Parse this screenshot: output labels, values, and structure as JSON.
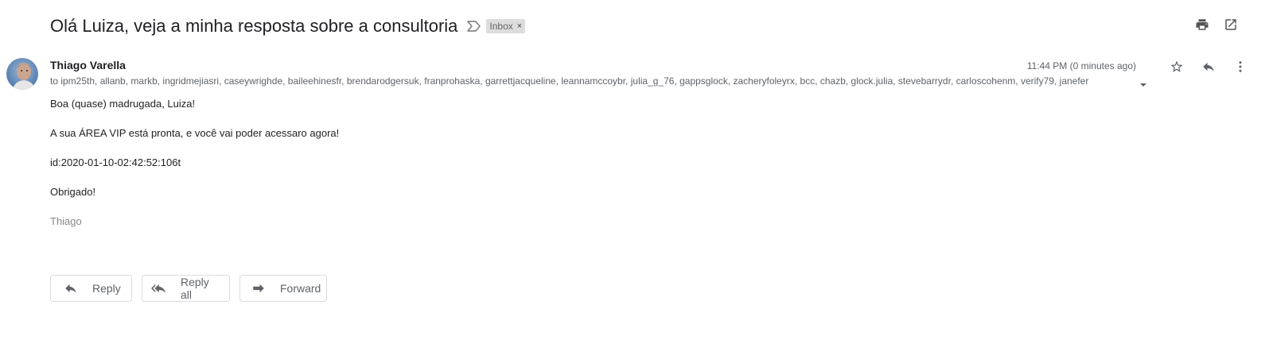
{
  "email": {
    "subject": "Olá Luiza, veja a minha resposta sobre a consultoria",
    "label": "Inbox",
    "label_close": "×",
    "sender_name": "Thiago Varella",
    "recipients": "to ipm25th, allanb, markb, ingridmejiasri, caseywrighde, baileehinesfr, brendarodgersuk, franprohaska, garrettjacqueline, leannamccoybr, julia_g_76, gappsglock, zacheryfoleyrx, bcc, chazb, glock.julia, stevebarrydr, carloscohenm, verify79, janefer",
    "timestamp": "11:44 PM (0 minutes ago)",
    "body": {
      "line1": "Boa (quase) madrugada, Luiza!",
      "line2": "A sua ÁREA VIP está pronta, e você vai poder acessaro agora!",
      "line3": "id:2020-01-10-02:42:52:106t",
      "line4": "Obrigado!",
      "signature": "Thiago"
    }
  },
  "actions": {
    "reply": "Reply",
    "reply_all": "Reply all",
    "forward": "Forward"
  },
  "icons": {
    "importance": "importance-marker-icon",
    "print": "print-icon",
    "open_new_window": "open-in-new-window-icon",
    "star": "star-icon",
    "reply": "reply-icon",
    "more": "more-vert-icon",
    "caret": "chevron-down-icon"
  },
  "colors": {
    "text_primary": "#202124",
    "text_secondary": "#5f6368",
    "chip_bg": "#dddddd",
    "border": "#dadce0"
  }
}
